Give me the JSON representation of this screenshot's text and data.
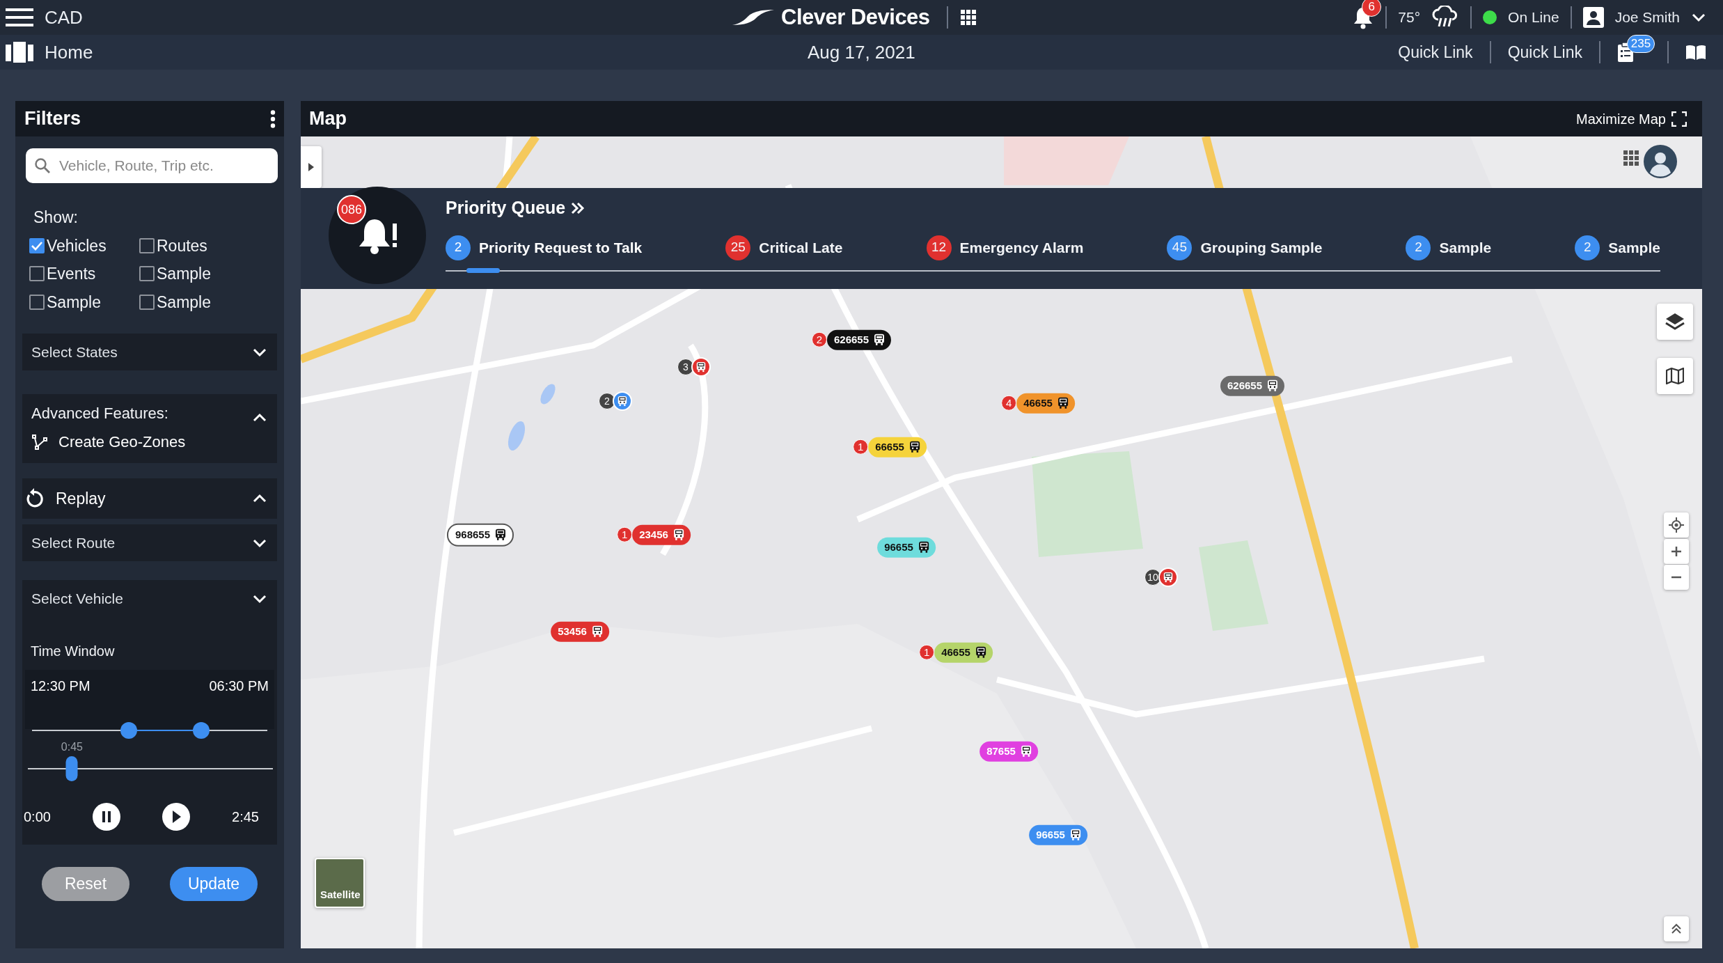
{
  "header": {
    "app_title": "CAD",
    "brand": "Clever Devices",
    "notifications": "6",
    "temperature": "75°",
    "status": {
      "label": "On Line",
      "color": "#3ddc4a"
    },
    "user": "Joe Smith",
    "page": "Home",
    "date": "Aug 17, 2021",
    "quick_links": [
      "Quick Link",
      "Quick Link"
    ],
    "tasks_count": "235"
  },
  "filters": {
    "title": "Filters",
    "search": {
      "placeholder": "Vehicle, Route, Trip etc."
    },
    "show_label": "Show:",
    "checkboxes": [
      {
        "label": "Vehicles",
        "checked": true
      },
      {
        "label": "Routes",
        "checked": false
      },
      {
        "label": "Events",
        "checked": false
      },
      {
        "label": "Sample",
        "checked": false
      },
      {
        "label": "Sample",
        "checked": false
      },
      {
        "label": "Sample",
        "checked": false
      }
    ],
    "states_select": "Select States",
    "advanced": {
      "title": "Advanced Features:",
      "expanded": true,
      "items": [
        "Create Geo-Zones"
      ]
    },
    "replay": {
      "title": "Replay",
      "expanded": true,
      "route_select": "Select Route",
      "vehicle_select": "Select Vehicle",
      "time_window_label": "Time Window",
      "start_time": "12:30 PM",
      "end_time": "06:30 PM",
      "range_start": {
        "level": 0.41
      },
      "range_end": {
        "level": 0.72
      },
      "playback": {
        "current": "0:45",
        "level": 0.18,
        "start": "0:00",
        "end": "2:45"
      }
    },
    "buttons": [
      "Reset",
      "Update"
    ]
  },
  "map": {
    "title": "Map",
    "maximize": "Maximize Map",
    "priority_queue": {
      "title": "Priority Queue",
      "count": "086",
      "tabs": [
        {
          "label": "Priority Request to Talk",
          "count": "2",
          "color": "#3d8ef0",
          "selected": true
        },
        {
          "label": "Critical Late",
          "count": "25",
          "color": "#e0312f",
          "selected": false
        },
        {
          "label": "Emergency Alarm",
          "count": "12",
          "color": "#e0312f",
          "selected": false
        },
        {
          "label": "Grouping Sample",
          "count": "45",
          "color": "#3d8ef0",
          "selected": false
        },
        {
          "label": "Sample",
          "count": "2",
          "color": "#3d8ef0",
          "selected": false
        },
        {
          "label": "Sample",
          "count": "2",
          "color": "#3d8ef0",
          "selected": false
        }
      ]
    },
    "vehicles": [
      {
        "id": "626655",
        "color": "#111111",
        "alert": "2"
      },
      {
        "id": "46655",
        "color": "#f0932b",
        "alert": "4"
      },
      {
        "id": "66655",
        "color": "#f5d33b",
        "alert": "1"
      },
      {
        "id": "626655",
        "color": "#6b6b6b"
      },
      {
        "id": "968655",
        "color": "#ffffff"
      },
      {
        "id": "23456",
        "color": "#e0312f",
        "alert": "1"
      },
      {
        "id": "96655",
        "color": "#6edcdc"
      },
      {
        "id": "53456",
        "color": "#e0312f"
      },
      {
        "id": "46655",
        "color": "#b5d46a",
        "alert": "1"
      },
      {
        "id": "87655",
        "color": "#e040e0"
      },
      {
        "id": "96655",
        "color": "#3d8ef0"
      }
    ],
    "stop_markers": [
      {
        "count": "3",
        "color": "#e0312f"
      },
      {
        "count": "2",
        "color": "#3d8ef0"
      },
      {
        "count": "10",
        "color": "#e0312f"
      }
    ],
    "satellite_label": "Satellite"
  }
}
